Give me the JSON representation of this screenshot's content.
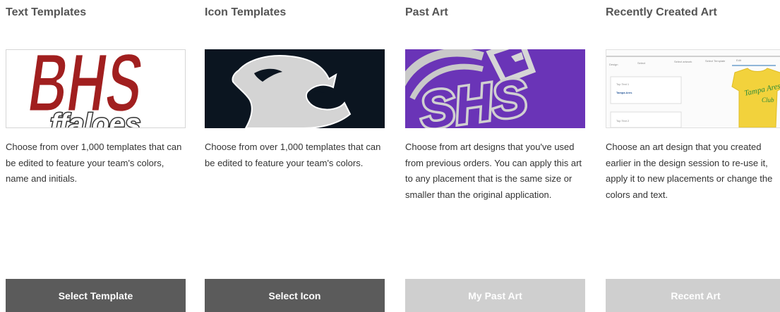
{
  "columns": [
    {
      "title": "Text Templates",
      "thumbnail_text": "BHS",
      "thumbnail_subtext": "ffaloes",
      "description": "Choose from over 1,000 templates that can be edited to feature your team's colors, name and initials.",
      "button_label": "Select Template"
    },
    {
      "title": "Icon Templates",
      "thumbnail_icon": "cougar-head-icon",
      "description": "Choose from over 1,000 templates that can be edited to feature your team's colors.",
      "button_label": "Select Icon"
    },
    {
      "title": "Past Art",
      "thumbnail_text": "SHS",
      "description": "Choose from art designs that you've used from previous orders. You can apply this art to any placement that is the same size or smaller than the original application.",
      "button_label": "My Past Art"
    },
    {
      "title": "Recently Created Art",
      "thumbnail_tabs": [
        "Design",
        "Select",
        "Select artwork",
        "Select Template",
        "Edit"
      ],
      "thumbnail_items": [
        "Top Text 1",
        "Tampa Ares",
        "Top Text 2"
      ],
      "thumbnail_shirt_text": [
        "Tampa Ares",
        "Club"
      ],
      "description": "Choose an art design that you created earlier in the design session to re-use it, apply it to new placements or change the colors and text.",
      "button_label": "Recent Art"
    }
  ],
  "colors": {
    "dark_button": "#5b5b5b",
    "light_button": "#cfcfcf",
    "bhs_red": "#a11f1f",
    "past_art_purple": "#6a34b7",
    "shirt_yellow": "#f2d23c"
  }
}
